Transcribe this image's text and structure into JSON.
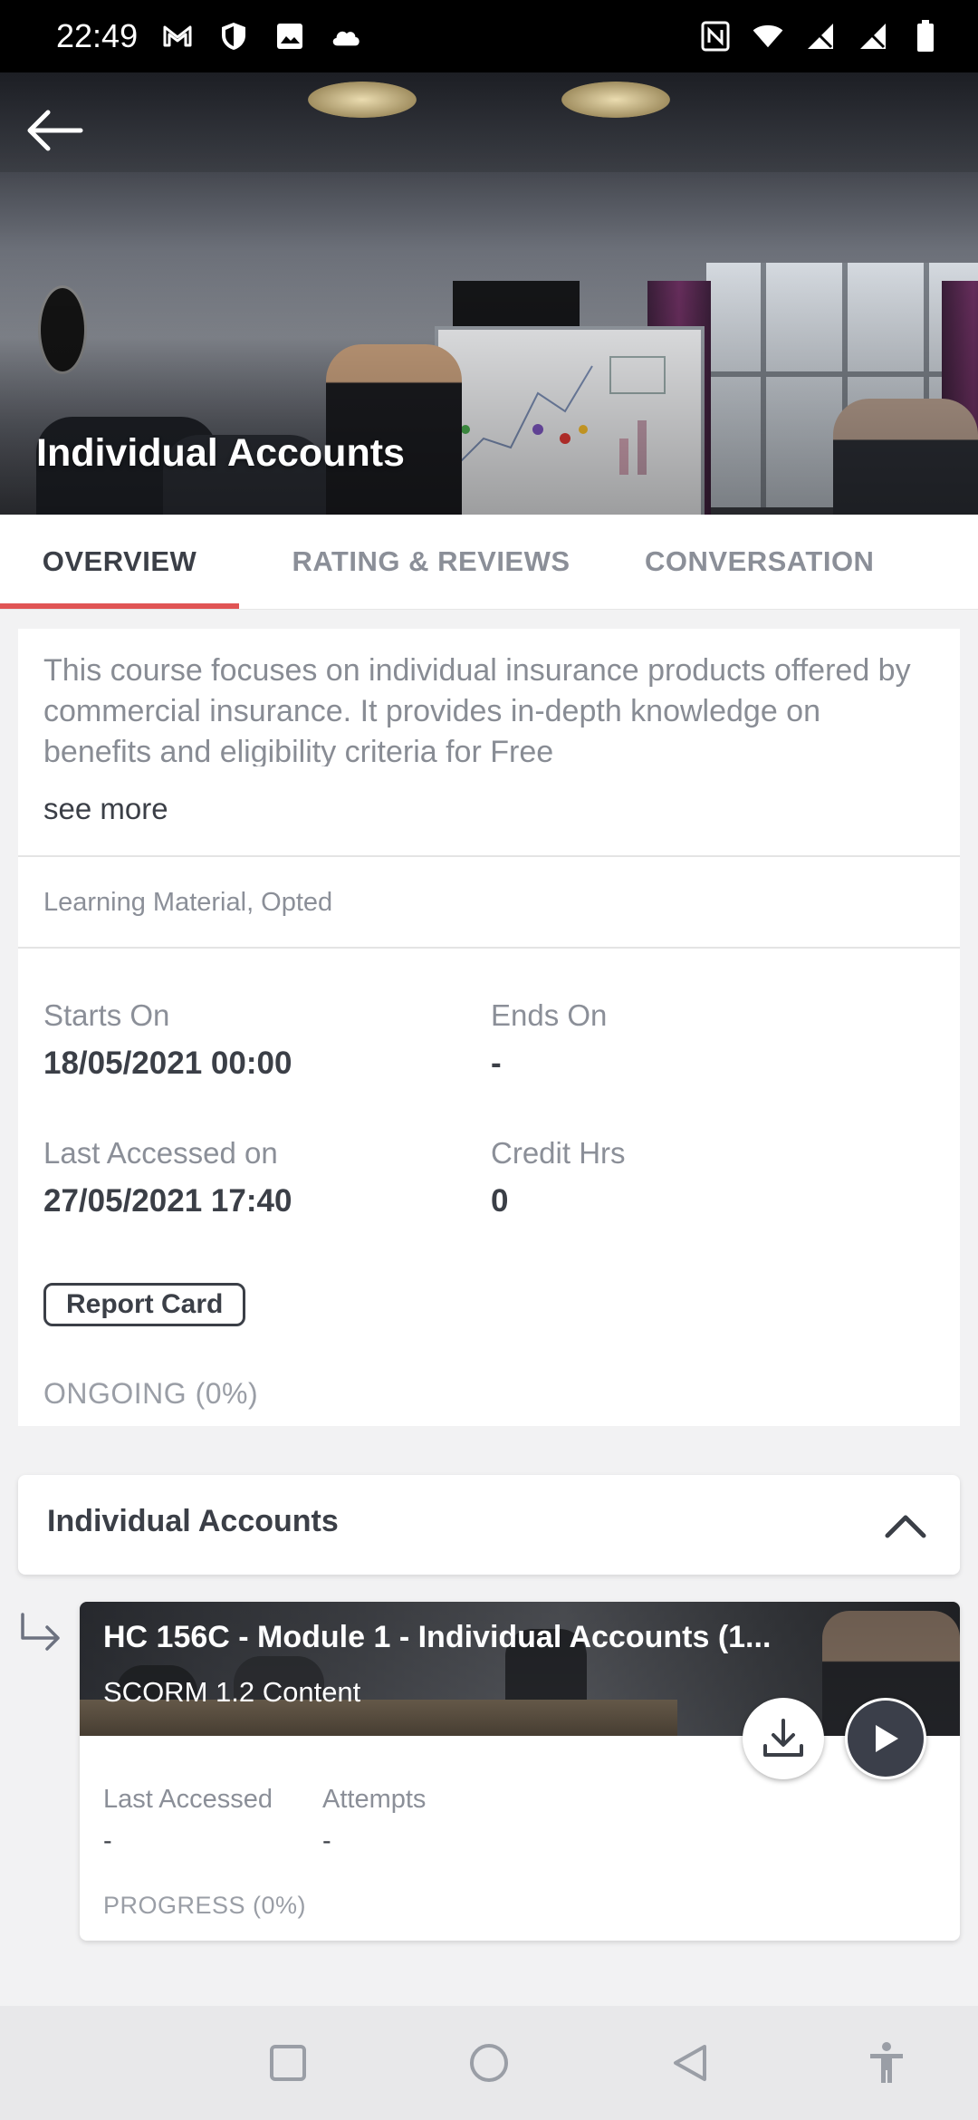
{
  "status_bar": {
    "time": "22:49"
  },
  "header": {
    "title": "Individual Accounts"
  },
  "tabs": [
    {
      "label": "OVERVIEW",
      "active": true
    },
    {
      "label": "RATING & REVIEWS",
      "active": false
    },
    {
      "label": "CONVERSATION",
      "active": false
    }
  ],
  "overview": {
    "description": "This course focuses on individual insurance products offered by commercial insurance. It provides in-depth knowledge on benefits and eligibility criteria for Free",
    "see_more": "see more",
    "tags": "Learning Material, Opted",
    "starts_on_label": "Starts On",
    "starts_on_value": "18/05/2021 00:00",
    "ends_on_label": "Ends On",
    "ends_on_value": "-",
    "last_accessed_label": "Last Accessed on",
    "last_accessed_value": "27/05/2021 17:40",
    "credit_hrs_label": "Credit Hrs",
    "credit_hrs_value": "0",
    "report_card": "Report Card",
    "status": "ONGOING (0%)"
  },
  "module": {
    "title": "Individual Accounts",
    "content": {
      "title": "HC 156C - Module 1 - Individual Accounts (1...",
      "type": "SCORM 1.2 Content",
      "last_accessed_label": "Last Accessed",
      "last_accessed_value": "-",
      "attempts_label": "Attempts",
      "attempts_value": "-",
      "progress": "PROGRESS (0%)",
      "progress_value": 0
    }
  },
  "colors": {
    "accent": "#e05454",
    "text_dark": "#3b3f47",
    "text_muted": "#8b8f98"
  },
  "icons": [
    "gmail-icon",
    "shield-icon",
    "image-icon",
    "cloud-icon",
    "nfc-icon",
    "wifi-icon",
    "no-signal-icon",
    "battery-icon",
    "back-arrow-icon",
    "chevron-up-icon",
    "subdirectory-arrow-icon",
    "download-icon",
    "play-icon",
    "recents-icon",
    "home-icon",
    "back-icon",
    "accessibility-icon"
  ]
}
